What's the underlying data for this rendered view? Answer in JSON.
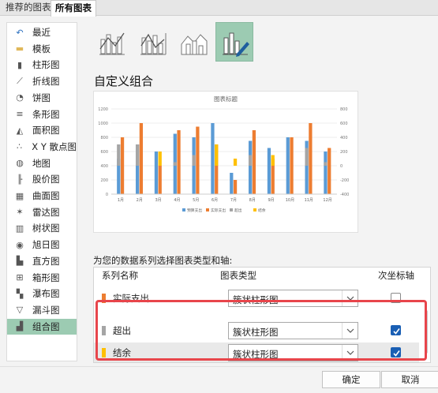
{
  "tabs": [
    {
      "label": "推荐的图表"
    },
    {
      "label": "所有图表"
    }
  ],
  "sidebar": {
    "items": [
      {
        "label": "最近",
        "icon": "recent-icon"
      },
      {
        "label": "模板",
        "icon": "folder-icon"
      },
      {
        "label": "柱形图",
        "icon": "column-chart-icon"
      },
      {
        "label": "折线图",
        "icon": "line-chart-icon"
      },
      {
        "label": "饼图",
        "icon": "pie-chart-icon"
      },
      {
        "label": "条形图",
        "icon": "bar-chart-icon"
      },
      {
        "label": "面积图",
        "icon": "area-chart-icon"
      },
      {
        "label": "X Y 散点图",
        "icon": "scatter-chart-icon"
      },
      {
        "label": "地图",
        "icon": "map-chart-icon"
      },
      {
        "label": "股价图",
        "icon": "stock-chart-icon"
      },
      {
        "label": "曲面图",
        "icon": "surface-chart-icon"
      },
      {
        "label": "雷达图",
        "icon": "radar-chart-icon"
      },
      {
        "label": "树状图",
        "icon": "treemap-chart-icon"
      },
      {
        "label": "旭日图",
        "icon": "sunburst-chart-icon"
      },
      {
        "label": "直方图",
        "icon": "histogram-chart-icon"
      },
      {
        "label": "箱形图",
        "icon": "box-whisker-chart-icon"
      },
      {
        "label": "瀑布图",
        "icon": "waterfall-chart-icon"
      },
      {
        "label": "漏斗图",
        "icon": "funnel-chart-icon"
      },
      {
        "label": "组合图",
        "icon": "combo-chart-icon"
      }
    ],
    "active_index": 18
  },
  "subtypes": [
    "combo-column-line-icon",
    "combo-column-line-secondary-icon",
    "combo-area-column-icon",
    "custom-combo-icon"
  ],
  "combo_title": "自定义组合",
  "preview": {
    "title": "图表标题",
    "legend": [
      "预算支出",
      "实际支出",
      "超出",
      "结余"
    ]
  },
  "chart_data": {
    "type": "bar",
    "title": "图表标题",
    "categories": [
      "1月",
      "2月",
      "3月",
      "4月",
      "5月",
      "6月",
      "7月",
      "8月",
      "9月",
      "10月",
      "11月",
      "12月"
    ],
    "series": [
      {
        "name": "预算支出",
        "color": "#5b9bd5",
        "axis": "primary",
        "values": [
          500,
          700,
          600,
          850,
          800,
          1000,
          300,
          750,
          650,
          800,
          750,
          600
        ]
      },
      {
        "name": "实际支出",
        "color": "#ed7d31",
        "axis": "primary",
        "values": [
          800,
          1000,
          400,
          900,
          950,
          700,
          200,
          900,
          500,
          800,
          1000,
          650
        ]
      },
      {
        "name": "超出",
        "color": "#a5a5a5",
        "axis": "secondary",
        "values": [
          300,
          300,
          0,
          50,
          150,
          0,
          0,
          150,
          0,
          0,
          250,
          50
        ]
      },
      {
        "name": "结余",
        "color": "#ffc000",
        "axis": "secondary",
        "values": [
          0,
          0,
          200,
          0,
          0,
          300,
          100,
          0,
          150,
          0,
          0,
          0
        ]
      }
    ],
    "ylim": [
      0,
      1200
    ],
    "y2lim": [
      -400,
      800
    ],
    "yticks": [
      "0",
      "200",
      "400",
      "600",
      "800",
      "1000",
      "1200"
    ],
    "y2ticks": [
      "-400",
      "-200",
      "0",
      "200",
      "400",
      "600",
      "800"
    ],
    "legend_position": "bottom"
  },
  "series_section_label": "为您的数据系列选择图表类型和轴:",
  "table": {
    "headers": [
      "系列名称",
      "图表类型",
      "次坐标轴"
    ],
    "rows": [
      {
        "name": "实际支出",
        "color": "#ed7d31",
        "chart_type": "簇状柱形图",
        "secondary": false
      },
      {
        "name": "超出",
        "color": "#a5a5a5",
        "chart_type": "簇状柱形图",
        "secondary": true
      },
      {
        "name": "结余",
        "color": "#ffc000",
        "chart_type": "簇状柱形图",
        "secondary": true
      }
    ]
  },
  "buttons": {
    "ok": "确定",
    "cancel": "取消"
  }
}
